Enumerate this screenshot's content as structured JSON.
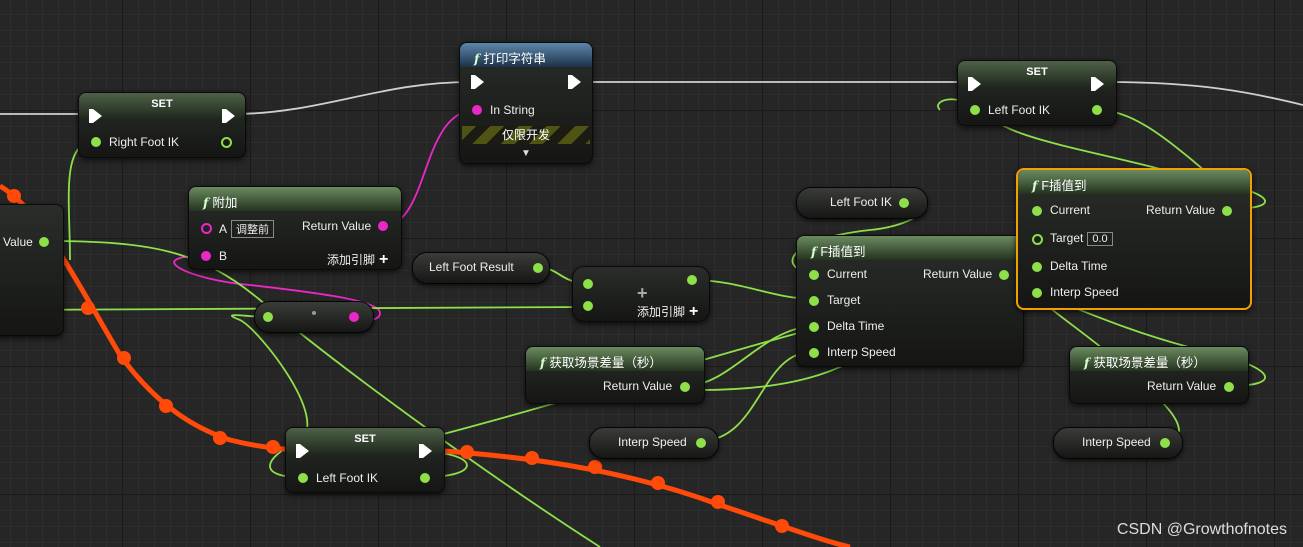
{
  "watermark": "CSDN @Growthofnotes",
  "nodes": {
    "set_right": {
      "title": "SET",
      "pin": "Right Foot IK"
    },
    "print_string": {
      "title": "打印字符串",
      "in": "In String",
      "dev_only": "仅限开发"
    },
    "set_left_top": {
      "title": "SET",
      "pin": "Left Foot IK"
    },
    "append": {
      "title": "附加",
      "a": "A",
      "a_box": "调整前",
      "b": "B",
      "ret": "Return Value",
      "add_pin": "添加引脚"
    },
    "left_value": {
      "out": "Value"
    },
    "left_foot_result": {
      "label": "Left Foot Result"
    },
    "add_node": {
      "add_pin": "添加引脚"
    },
    "left_foot_ik_var": {
      "label": "Left Foot IK"
    },
    "finterp_mid": {
      "title": "F插值到",
      "current": "Current",
      "target": "Target",
      "delta": "Delta Time",
      "interp": "Interp Speed",
      "ret": "Return Value"
    },
    "finterp_right": {
      "title": "F插值到",
      "current": "Current",
      "target": "Target",
      "target_val": "0.0",
      "delta": "Delta Time",
      "interp": "Interp Speed",
      "ret": "Return Value"
    },
    "delta_left": {
      "title": "获取场景差量（秒）",
      "ret": "Return Value"
    },
    "delta_right": {
      "title": "获取场景差量（秒）",
      "ret": "Return Value"
    },
    "interp_speed_left": {
      "label": "Interp Speed"
    },
    "interp_speed_right": {
      "label": "Interp Speed"
    },
    "set_left_bottom": {
      "title": "SET",
      "pin": "Left Foot IK"
    }
  },
  "colors": {
    "float_pin": "#8ee04a",
    "string_pin": "#ec27c7",
    "exec_wire": "#ffffff",
    "selected": "#f0a000",
    "active_wire": "#ff4a0a"
  }
}
